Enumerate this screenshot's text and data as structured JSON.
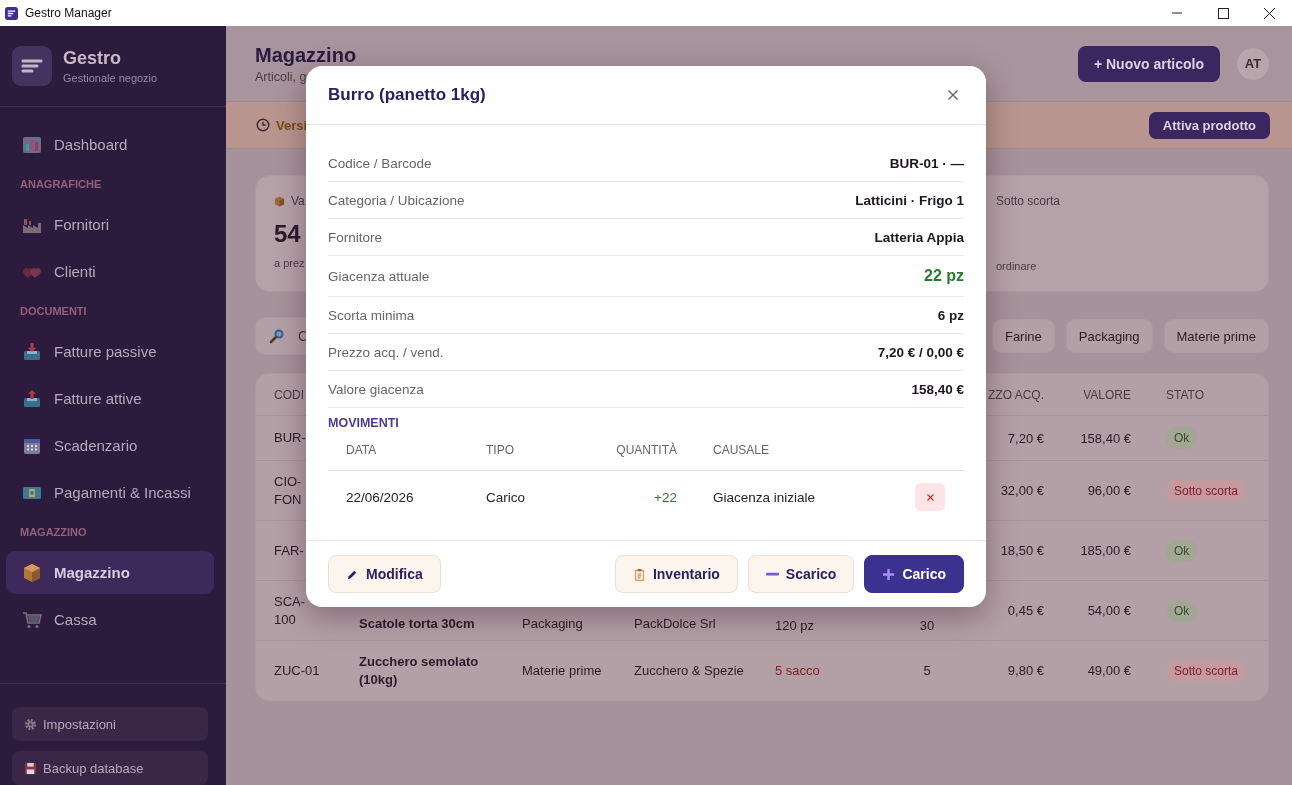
{
  "titlebar": {
    "title": "Gestro Manager"
  },
  "sidebar": {
    "brand": "Gestro",
    "tagline": "Gestionale negozio",
    "nav": [
      {
        "kind": "item",
        "label": "Dashboard",
        "selected": false
      },
      {
        "kind": "section",
        "label": "ANAGRAFICHE"
      },
      {
        "kind": "item",
        "label": "Fornitori",
        "selected": false
      },
      {
        "kind": "item",
        "label": "Clienti",
        "selected": false
      },
      {
        "kind": "section",
        "label": "DOCUMENTI"
      },
      {
        "kind": "item",
        "label": "Fatture passive",
        "selected": false
      },
      {
        "kind": "item",
        "label": "Fatture attive",
        "selected": false
      },
      {
        "kind": "item",
        "label": "Scadenzario",
        "selected": false
      },
      {
        "kind": "item",
        "label": "Pagamenti & Incassi",
        "selected": false
      },
      {
        "kind": "section",
        "label": "MAGAZZINO"
      },
      {
        "kind": "item",
        "label": "Magazzino",
        "selected": true
      },
      {
        "kind": "item",
        "label": "Cassa",
        "selected": false
      }
    ],
    "footer_buttons": [
      "Impostazioni",
      "Backup database"
    ]
  },
  "header": {
    "title": "Magazzino",
    "subtitle": "Articoli, g",
    "new_button": "+ Nuovo articolo",
    "avatar": "AT"
  },
  "banner": {
    "text": "Versi",
    "button": "Attiva prodotto"
  },
  "stats": [
    {
      "label": "Va",
      "value": "54",
      "note": "a prez"
    },
    {
      "label": "Sotto scorta",
      "note": "ordinare"
    }
  ],
  "search": {
    "placeholder": "C"
  },
  "chips": [
    "Farine",
    "Packaging",
    "Materie prime"
  ],
  "table": {
    "columns": {
      "code": "CODI",
      "price": "ZZO ACQ.",
      "value": "VALORE",
      "status": "STATO"
    },
    "rows": [
      {
        "code": "BUR-",
        "price": "7,20 €",
        "value": "158,40 €",
        "status": {
          "label": "Ok",
          "kind": "ok"
        }
      },
      {
        "code": "CIO-FON",
        "price": "32,00 €",
        "value": "96,00 €",
        "status": {
          "label": "Sotto scorta",
          "kind": "low"
        }
      },
      {
        "code": "FAR-",
        "price": "18,50 €",
        "value": "185,00 €",
        "status": {
          "label": "Ok",
          "kind": "ok"
        }
      },
      {
        "code": "SCA-100",
        "name": "Scatole torta 30cm",
        "category": "Packaging",
        "supplier": "PackDolce Srl",
        "stock": {
          "text": "120 pz",
          "low": false
        },
        "min": "30",
        "price": "0,45 €",
        "value": "54,00 €",
        "status": {
          "label": "Ok",
          "kind": "ok"
        }
      },
      {
        "code": "ZUC-01",
        "name": "Zucchero semolato (10kg)",
        "category": "Materie prime",
        "supplier": "Zucchero & Spezie",
        "stock": {
          "text": "5 sacco",
          "low": true
        },
        "min": "5",
        "price": "9,80 €",
        "value": "49,00 €",
        "status": {
          "label": "Sotto scorta",
          "kind": "low"
        }
      }
    ]
  },
  "modal": {
    "title": "Burro (panetto 1kg)",
    "details": [
      {
        "label": "Codice / Barcode",
        "value": "BUR-01 · —",
        "kind": "plain"
      },
      {
        "label": "Categoria / Ubicazione",
        "value": "Latticini · Frigo 1",
        "kind": "plain"
      },
      {
        "label": "Fornitore",
        "value": "Latteria Appia",
        "kind": "plain"
      },
      {
        "label": "Giacenza attuale",
        "value": "22 pz",
        "kind": "stock"
      },
      {
        "label": "Scorta minima",
        "value": "6 pz",
        "kind": "plain"
      },
      {
        "label": "Prezzo acq. / vend.",
        "value": "7,20 € / 0,00 €",
        "kind": "plain"
      },
      {
        "label": "Valore giacenza",
        "value": "158,40 €",
        "kind": "plain"
      }
    ],
    "movements": {
      "title": "MOVIMENTI",
      "columns": [
        "DATA",
        "TIPO",
        "QUANTITÀ",
        "CAUSALE"
      ],
      "rows": [
        {
          "date": "22/06/2026",
          "type": "Carico",
          "quantity": "+22",
          "reason": "Giacenza iniziale",
          "kind": "in"
        }
      ]
    },
    "actions": [
      {
        "label": "Modifica",
        "kind": "edit"
      },
      {
        "label": "Inventario",
        "kind": "inventory"
      },
      {
        "label": "Scarico",
        "kind": "unload"
      },
      {
        "label": "Carico",
        "kind": "load"
      }
    ]
  }
}
